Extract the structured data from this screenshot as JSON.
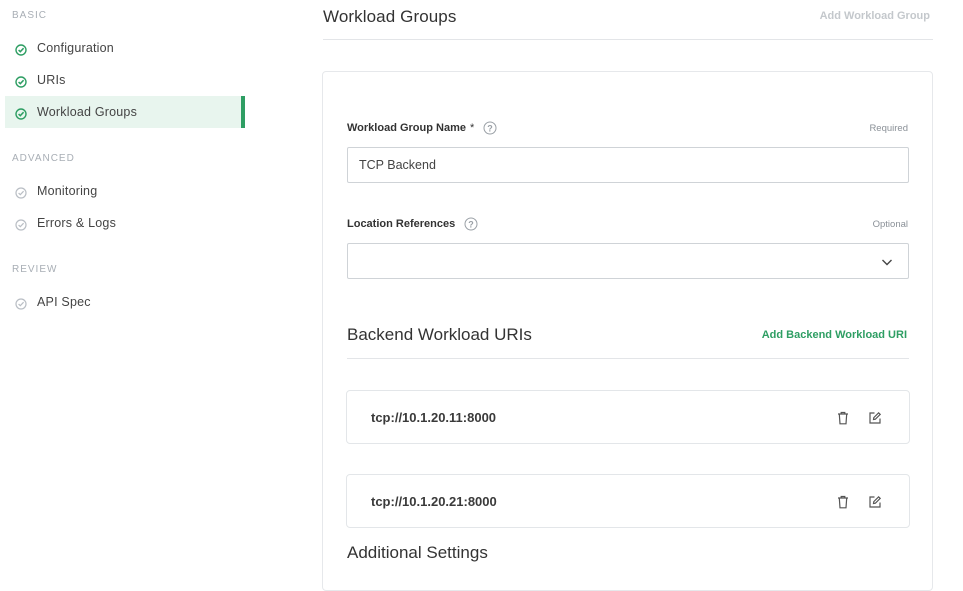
{
  "sidebar": {
    "sections": [
      {
        "label": "BASIC",
        "items": [
          {
            "label": "Configuration",
            "active": false,
            "complete": true
          },
          {
            "label": "URIs",
            "active": false,
            "complete": true
          },
          {
            "label": "Workload Groups",
            "active": true,
            "complete": true
          }
        ]
      },
      {
        "label": "ADVANCED",
        "items": [
          {
            "label": "Monitoring",
            "active": false,
            "complete": false
          },
          {
            "label": "Errors & Logs",
            "active": false,
            "complete": false
          }
        ]
      },
      {
        "label": "REVIEW",
        "items": [
          {
            "label": "API Spec",
            "active": false,
            "complete": false
          }
        ]
      }
    ],
    "icon_complete": "check-circle-icon",
    "icon_incomplete": "check-circle-outline-icon"
  },
  "header": {
    "title": "Workload Groups",
    "add_group_label": "Add Workload Group"
  },
  "form": {
    "name_field": {
      "label": "Workload Group Name",
      "required_marker": "*",
      "hint": "Required",
      "value": "TCP Backend"
    },
    "location_field": {
      "label": "Location References",
      "hint": "Optional",
      "value": ""
    },
    "backend": {
      "title": "Backend Workload URIs",
      "add_label": "Add Backend Workload URI",
      "uris": [
        {
          "value": "tcp://10.1.20.11:8000"
        },
        {
          "value": "tcp://10.1.20.21:8000"
        }
      ]
    },
    "additional_title": "Additional Settings"
  },
  "colors": {
    "accent": "#2e9e63",
    "active_bg": "#e8f5ee",
    "muted": "#c4c8cc"
  }
}
